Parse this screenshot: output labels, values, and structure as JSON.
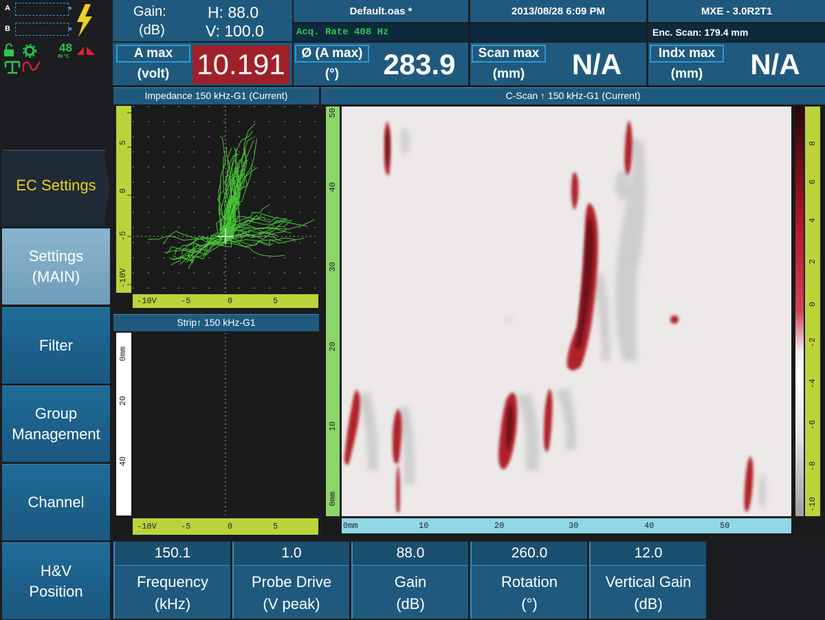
{
  "status": {
    "a_label": "A",
    "b_label": "B",
    "temp": "48",
    "temp_unit": "IN °C"
  },
  "header": {
    "gain_label": "Gain:",
    "gain_unit": "(dB)",
    "gain_h": "H: 88.0",
    "gain_v": "V: 100.0",
    "filename": "Default.oas *",
    "acq_rate": "Acq. Rate 408  Hz",
    "datetime": "2013/08/28 6:09 PM",
    "version": "MXE - 3.0R2T1",
    "enc_scan": "Enc. Scan:  179.4 mm"
  },
  "readings": {
    "amax_label": "A max",
    "amax_unit": "(volt)",
    "amax_value": "10.191",
    "phase_label": "Ø (A max)",
    "phase_unit": "(°)",
    "phase_value": "283.9",
    "scanmax_label": "Scan max",
    "scanmax_unit": "(mm)",
    "scanmax_value": "N/A",
    "indxmax_label": "Indx max",
    "indxmax_unit": "(mm)",
    "indxmax_value": "N/A"
  },
  "impedance": {
    "title": "Impedance 150 kHz-G1 (Current)",
    "y_ticks": [
      "5",
      "0",
      "-5",
      "-10V"
    ],
    "x_ticks": [
      "-10V",
      "-5",
      "0",
      "5"
    ]
  },
  "strip": {
    "title": "Strip↑ 150 kHz-G1",
    "y_ticks": [
      "0mm",
      "20",
      "40"
    ],
    "x_ticks": [
      "-10V",
      "-5",
      "0",
      "5"
    ]
  },
  "cscan": {
    "title": "C-Scan ↑ 150 kHz-G1 (Current)",
    "y_ticks": [
      "50",
      "40",
      "30",
      "20",
      "10",
      "0mm"
    ],
    "x_ticks": [
      "0mm",
      "10",
      "20",
      "30",
      "40",
      "50"
    ],
    "color_ticks": [
      "8",
      "6",
      "4",
      "2",
      "0",
      "-2",
      "-4",
      "-6",
      "-8",
      "-10"
    ],
    "colors": {
      "background": "#ece9e8",
      "defect": "#b0202c",
      "defect_dark": "#5a0e14",
      "shadow": "#c9c9c9"
    }
  },
  "menu": {
    "items": [
      "EC Settings",
      "Settings\n(MAIN)",
      "Filter",
      "Group\nManagement",
      "Channel",
      "H&V\nPosition"
    ]
  },
  "params": [
    {
      "value": "150.1",
      "label": "Frequency",
      "unit": "(kHz)"
    },
    {
      "value": "1.0",
      "label": "Probe Drive",
      "unit": "(V peak)"
    },
    {
      "value": "88.0",
      "label": "Gain",
      "unit": "(dB)"
    },
    {
      "value": "260.0",
      "label": "Rotation",
      "unit": "(°)"
    },
    {
      "value": "12.0",
      "label": "Vertical Gain",
      "unit": "(dB)"
    }
  ]
}
